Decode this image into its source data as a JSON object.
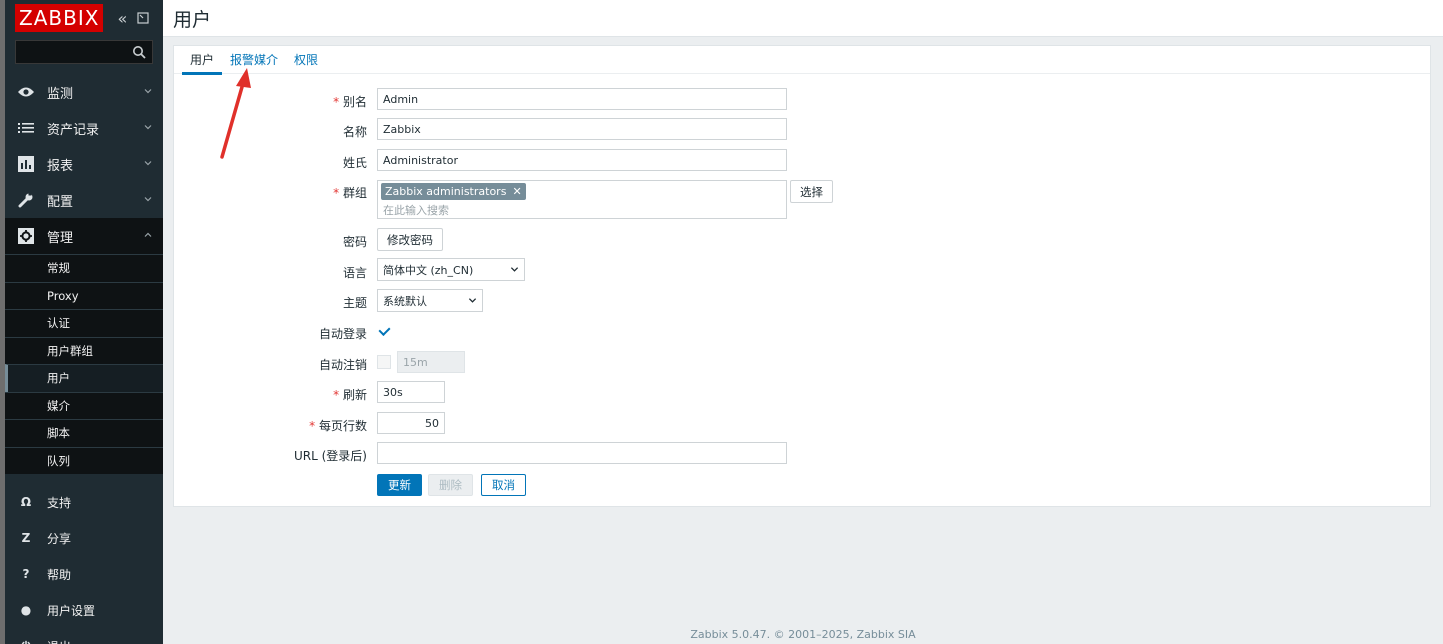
{
  "sidebar": {
    "logo": "ZABBIX",
    "search": {
      "value": "",
      "placeholder": ""
    },
    "menu": [
      {
        "label": "监测",
        "icon": "eye-icon"
      },
      {
        "label": "资产记录",
        "icon": "list-icon"
      },
      {
        "label": "报表",
        "icon": "bar-chart-icon"
      },
      {
        "label": "配置",
        "icon": "wrench-icon"
      },
      {
        "label": "管理",
        "icon": "gear-icon"
      }
    ],
    "admin_submenu": [
      "常规",
      "Proxy",
      "认证",
      "用户群组",
      "用户",
      "媒介",
      "脚本",
      "队列"
    ],
    "selected_submenu": "用户",
    "bottom": [
      {
        "label": "支持",
        "icon": "headset-icon",
        "glyph": "Ω"
      },
      {
        "label": "分享",
        "icon": "share-icon",
        "glyph": "Z"
      },
      {
        "label": "帮助",
        "icon": "help-icon",
        "glyph": "?"
      },
      {
        "label": "用户设置",
        "icon": "user-icon",
        "glyph": "●"
      },
      {
        "label": "退出",
        "icon": "power-icon",
        "glyph": "⏻"
      }
    ]
  },
  "header": {
    "title": "用户"
  },
  "tabs": [
    {
      "label": "用户",
      "active": true
    },
    {
      "label": "报警媒介",
      "active": false
    },
    {
      "label": "权限",
      "active": false
    }
  ],
  "form": {
    "alias_label": "别名",
    "alias_value": "Admin",
    "name_label": "名称",
    "name_value": "Zabbix",
    "surname_label": "姓氏",
    "surname_value": "Administrator",
    "groups_label": "群组",
    "group_tag": "Zabbix administrators",
    "groups_placeholder": "在此输入搜索",
    "select_button": "选择",
    "password_label": "密码",
    "change_password_button": "修改密码",
    "language_label": "语言",
    "language_value": "简体中文 (zh_CN)",
    "theme_label": "主题",
    "theme_value": "系统默认",
    "autologin_label": "自动登录",
    "autologin_checked": true,
    "autologout_label": "自动注销",
    "autologout_checked": false,
    "autologout_value": "15m",
    "refresh_label": "刷新",
    "refresh_value": "30s",
    "rows_label": "每页行数",
    "rows_value": "50",
    "url_label": "URL (登录后)",
    "url_value": ""
  },
  "actions": {
    "update": "更新",
    "delete": "删除",
    "cancel": "取消"
  },
  "footer": "Zabbix 5.0.47. © 2001–2025, Zabbix SIA",
  "colors": {
    "accent": "#0275b8",
    "sidebar": "#1f2c33",
    "logo": "#d40000",
    "annotation_arrow": "#e0302a"
  }
}
